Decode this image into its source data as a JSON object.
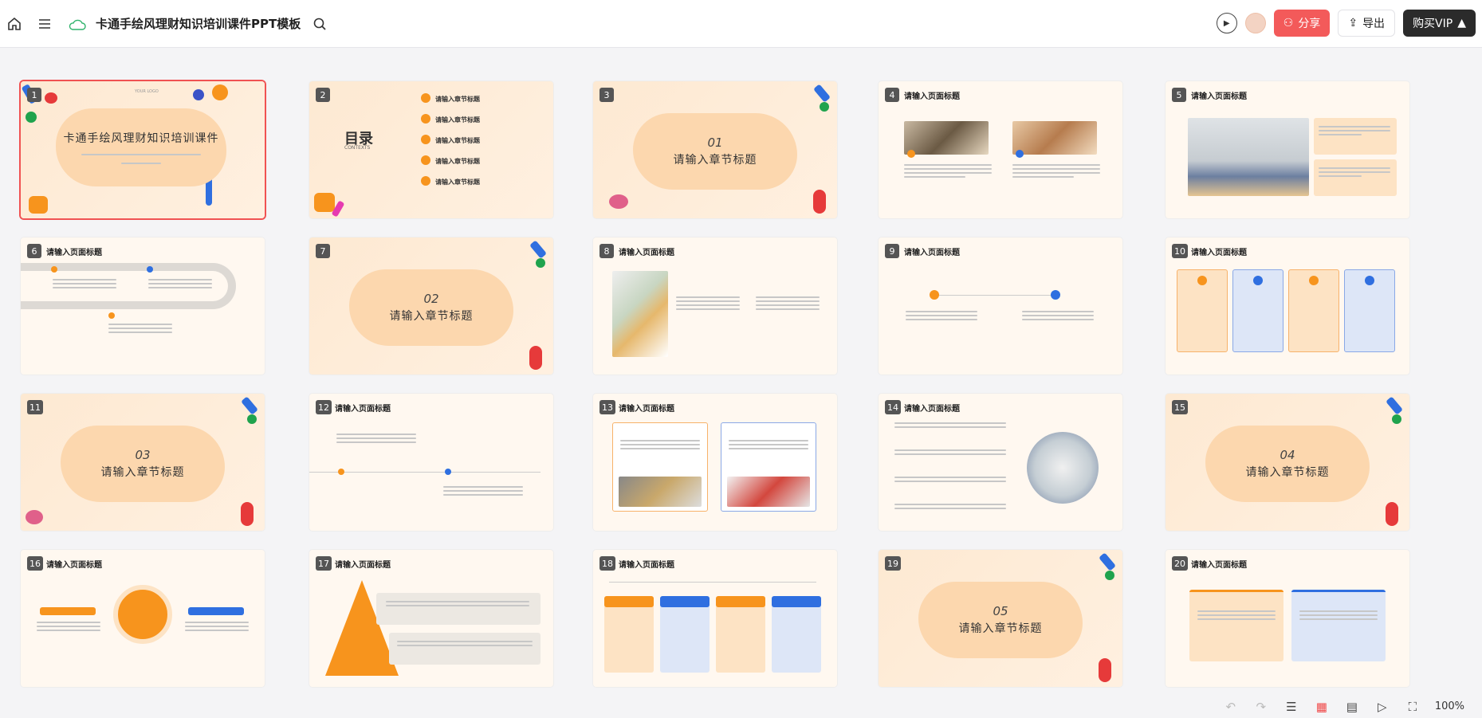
{
  "header": {
    "title": "卡通手绘风理财知识培训课件PPT模板",
    "share_label": "分享",
    "export_label": "导出",
    "vip_label": "购买VIP"
  },
  "slides": [
    {
      "num": "1",
      "title": "卡通手绘风理财知识培训课件",
      "logo": "YOUR LOGO"
    },
    {
      "num": "2",
      "title": "目录",
      "sub": "CONTEXTS",
      "items": [
        "请输入章节标题",
        "请输入章节标题",
        "请输入章节标题",
        "请输入章节标题",
        "请输入章节标题"
      ]
    },
    {
      "num": "3",
      "section": "01",
      "title": "请输入章节标题"
    },
    {
      "num": "4",
      "title": "请输入页面标题"
    },
    {
      "num": "5",
      "title": "请输入页面标题"
    },
    {
      "num": "6",
      "title": "请输入页面标题"
    },
    {
      "num": "7",
      "section": "02",
      "title": "请输入章节标题"
    },
    {
      "num": "8",
      "title": "请输入页面标题"
    },
    {
      "num": "9",
      "title": "请输入页面标题"
    },
    {
      "num": "10",
      "title": "请输入页面标题"
    },
    {
      "num": "11",
      "section": "03",
      "title": "请输入章节标题"
    },
    {
      "num": "12",
      "title": "请输入页面标题"
    },
    {
      "num": "13",
      "title": "请输入页面标题"
    },
    {
      "num": "14",
      "title": "请输入页面标题"
    },
    {
      "num": "15",
      "section": "04",
      "title": "请输入章节标题"
    },
    {
      "num": "16",
      "title": "请输入页面标题"
    },
    {
      "num": "17",
      "title": "请输入页面标题"
    },
    {
      "num": "18",
      "title": "请输入页面标题"
    },
    {
      "num": "19",
      "section": "05",
      "title": "请输入章节标题"
    },
    {
      "num": "20",
      "title": "请输入页面标题"
    }
  ],
  "footer": {
    "zoom": "100%"
  },
  "colors": {
    "accent_orange": "#f7941d",
    "accent_blue": "#2f6fe0",
    "share_red": "#f35a5a",
    "blob": "#fcd7ae"
  }
}
